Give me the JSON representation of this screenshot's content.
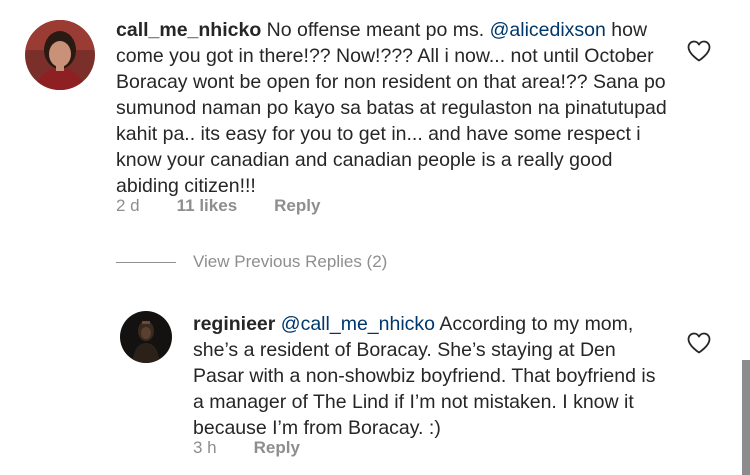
{
  "comment": {
    "username": "call_me_nhicko",
    "text_before_mention": " No offense meant po ms. ",
    "mention": "@alicedixson",
    "text_after_mention": " how come you got in there!?? Now!??? All i now... not until October Boracay wont be open for non resident on that area!?? Sana po sumunod naman po kayo sa batas at regulaston na pinatutupad kahit pa.. its easy for you to get in... and have some respect i know your canadian and canadian people is a really good abiding citizen!!!",
    "time": "2 d",
    "likes": "11 likes",
    "reply_label": "Reply",
    "like_icon": "heart-outline-icon"
  },
  "view_replies": {
    "label": "View Previous Replies (2)"
  },
  "reply": {
    "username": "reginieer",
    "mention": "@call_me_nhicko",
    "text_after_mention": " According to my mom, she’s a resident of Boracay. She’s staying at Den Pasar with a non-showbiz boyfriend. That boyfriend is a manager of The Lind if I’m not mistaken. I know it because I’m from Boracay. :)",
    "time": "3 h",
    "reply_label": "Reply",
    "like_icon": "heart-outline-icon"
  },
  "colors": {
    "text": "#262626",
    "mention": "#00376b",
    "secondary": "#8e8e8e"
  }
}
